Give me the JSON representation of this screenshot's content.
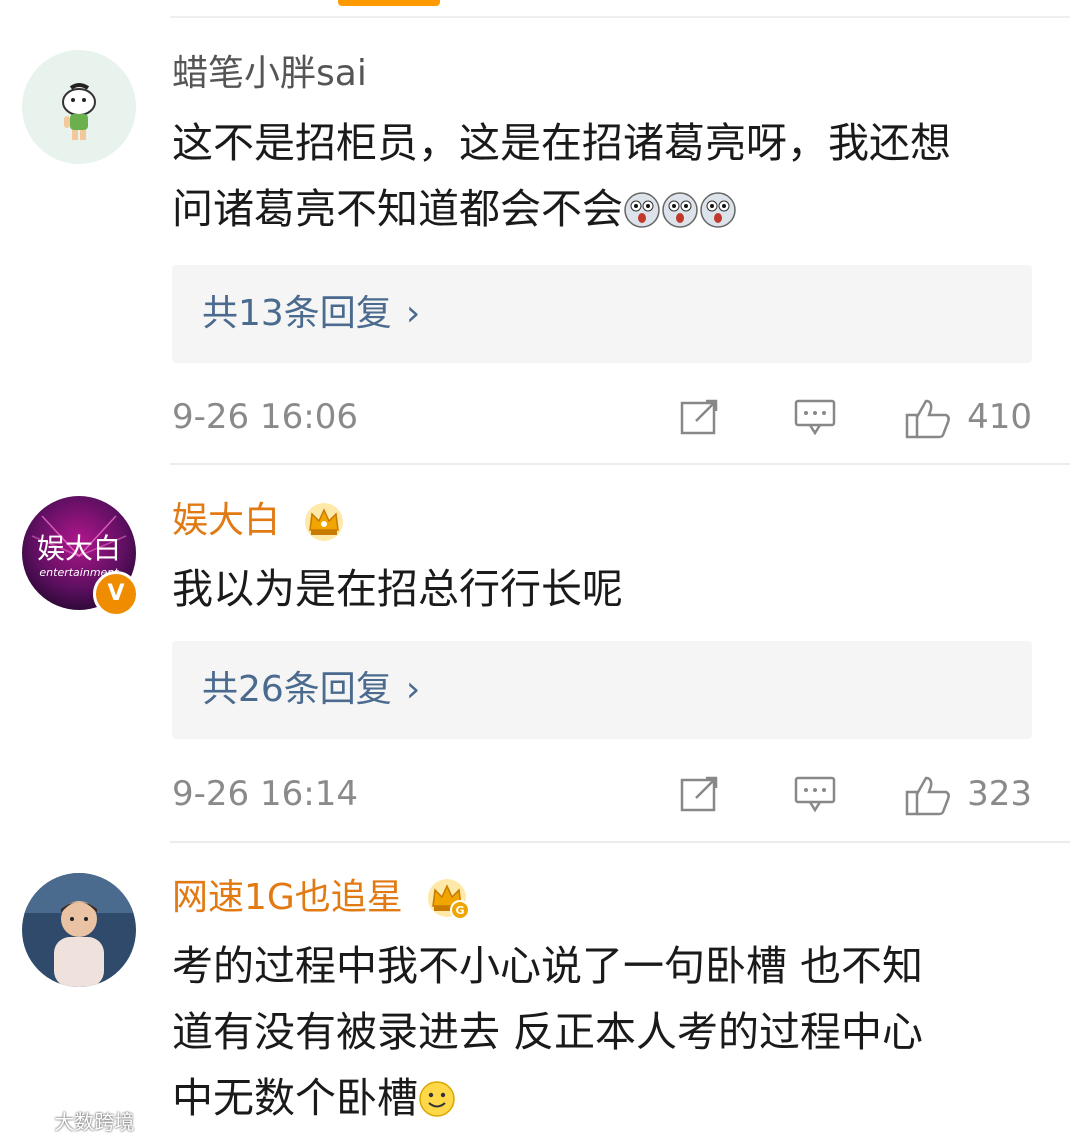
{
  "comments": [
    {
      "username": "蜡笔小胖sai",
      "vip": false,
      "verified": false,
      "text_lines": [
        "这不是招柜员，这是在招诸葛亮呀，我还想",
        "问诸葛亮不知道都会不会"
      ],
      "trailing_emoji": [
        "shocked-face-emoji",
        "shocked-face-emoji",
        "shocked-face-emoji"
      ],
      "replies": "共13条回复",
      "time": "9-26 16:06",
      "likes": "410"
    },
    {
      "username": "娱大白",
      "vip": true,
      "verified": true,
      "avatar_text": "娱大白",
      "avatar_subtext": "entertainment",
      "verified_mark": "V",
      "text_lines": [
        "我以为是在招总行行长呢"
      ],
      "replies": "共26条回复",
      "time": "9-26 16:14",
      "likes": "323"
    },
    {
      "username": "网速1G也追星",
      "vip": true,
      "vip_badge": "G",
      "verified": false,
      "text_lines": [
        "考的过程中我不小心说了一句卧槽 也不知",
        "道有没有被录进去 反正本人考的过程中心",
        "中无数个卧槽"
      ],
      "trailing_emoji": [
        "smile-emoji"
      ]
    }
  ],
  "watermark": "大数跨境",
  "colors": {
    "vip_name": "#e27a13",
    "link": "#4a6a8e",
    "meta": "#8a8a8a",
    "verified": "#f08c00"
  },
  "icons": [
    "repost-icon",
    "comment-icon",
    "like-icon",
    "crown-icon"
  ]
}
